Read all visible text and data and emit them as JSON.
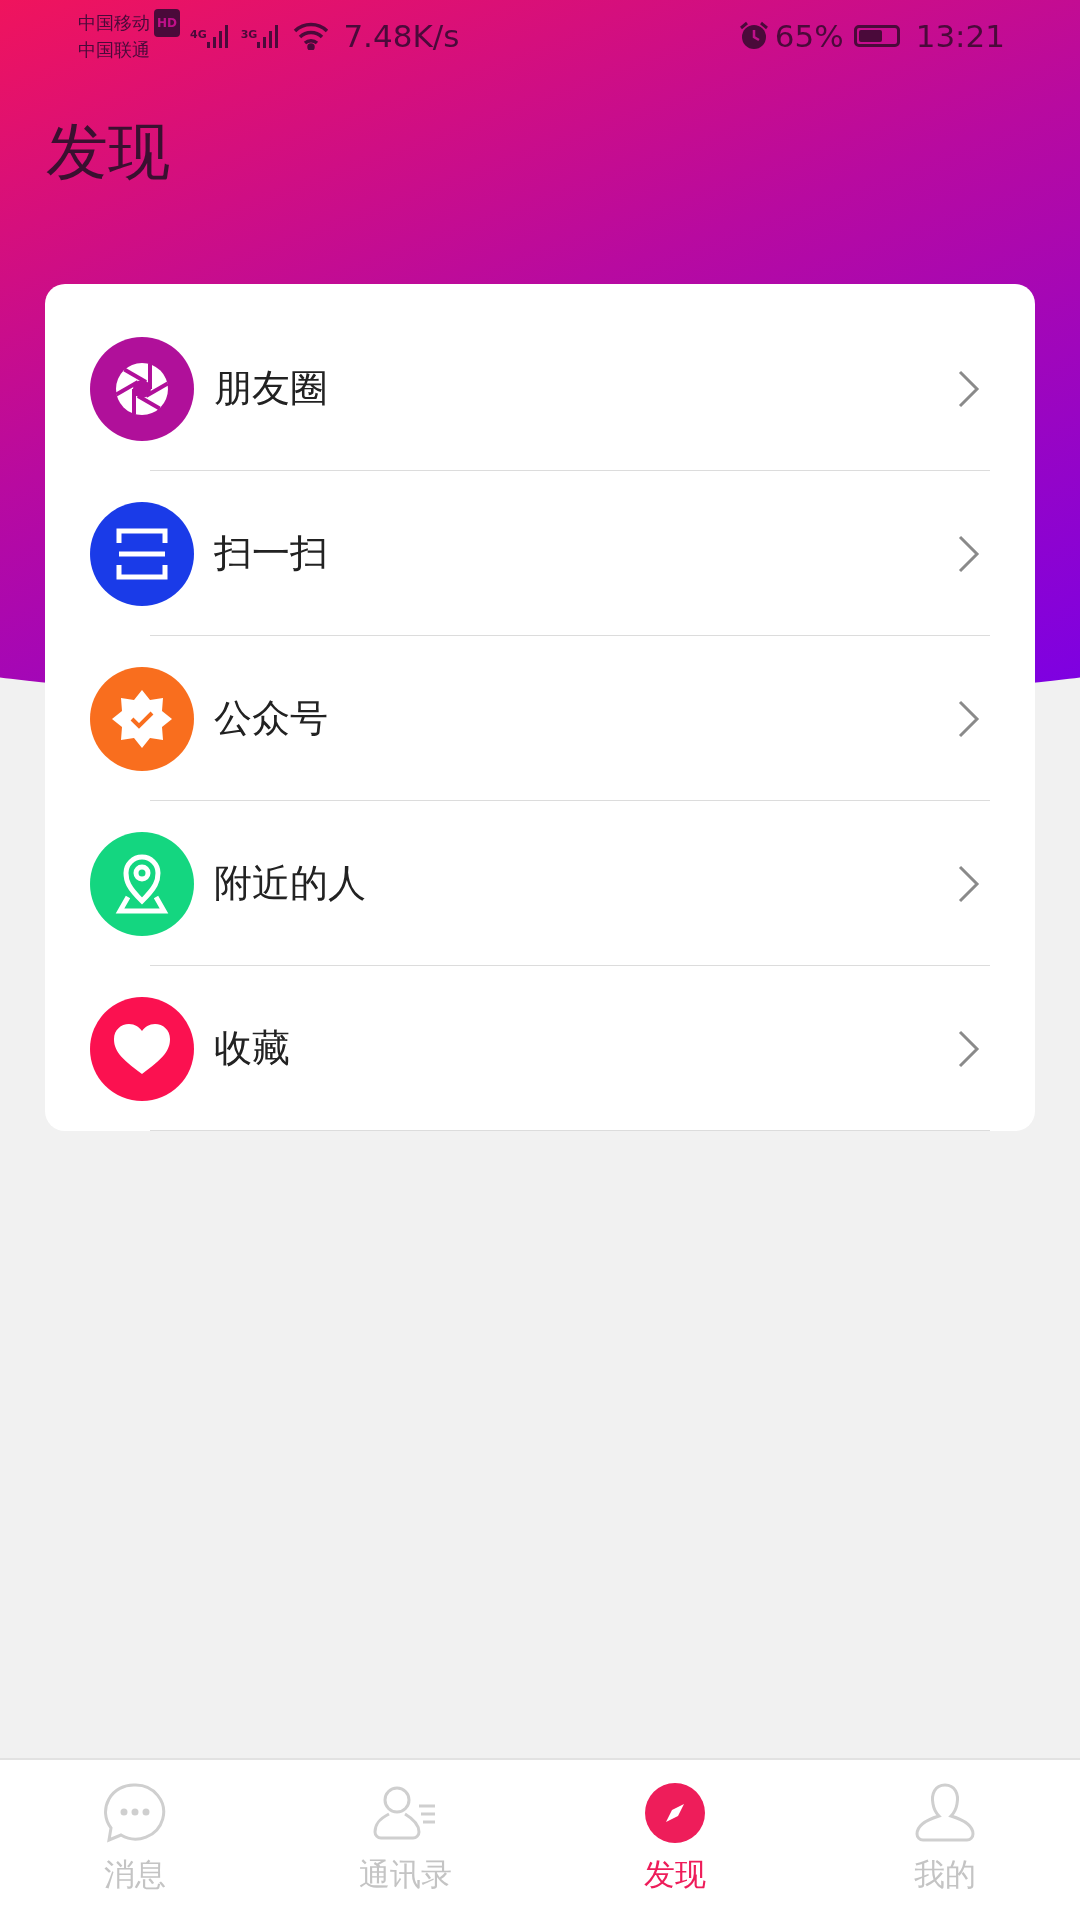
{
  "status_bar": {
    "carriers": [
      "中国移动",
      "中国联通"
    ],
    "hd_badge": "HD",
    "signals": [
      "4G",
      "3G"
    ],
    "speed": "7.48K/s",
    "battery_percent": "65%",
    "time": "13:21"
  },
  "title": "发现",
  "items": [
    {
      "kind": "moments",
      "label": "朋友圈",
      "color": "#b0109a"
    },
    {
      "kind": "scan",
      "label": "扫一扫",
      "color": "#1a3be8"
    },
    {
      "kind": "official",
      "label": "公众号",
      "color": "#f96e1e"
    },
    {
      "kind": "nearby",
      "label": "附近的人",
      "color": "#14d680"
    },
    {
      "kind": "favorites",
      "label": "收藏",
      "color": "#fb1150"
    }
  ],
  "tabs": [
    {
      "kind": "messages",
      "label": "消息",
      "selected": false
    },
    {
      "kind": "contacts",
      "label": "通讯录",
      "selected": false
    },
    {
      "kind": "discover",
      "label": "发现",
      "selected": true
    },
    {
      "kind": "me",
      "label": "我的",
      "selected": false
    }
  ]
}
